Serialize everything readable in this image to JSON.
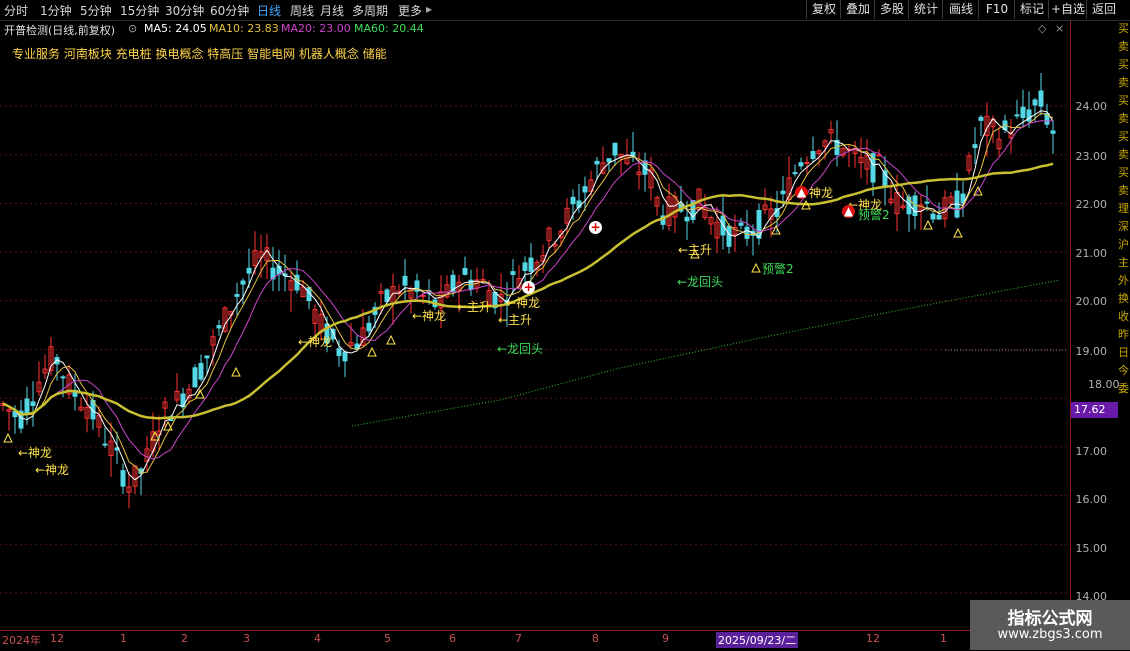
{
  "toolbar": {
    "periods": [
      "分时",
      "1分钟",
      "5分钟",
      "15分钟",
      "30分钟",
      "60分钟",
      "日线",
      "周线",
      "月线",
      "多周期",
      "更多"
    ],
    "active_period": "日线",
    "buttons": [
      "复权",
      "叠加",
      "多股",
      "统计",
      "画线",
      "F10",
      "标记",
      "+自选",
      "返回"
    ]
  },
  "info": {
    "stock_title": "开普检测(日线,前复权)",
    "ma5": "MA5: 24.05",
    "ma10": "MA10: 23.83",
    "ma20": "MA20: 23.00",
    "ma60": "MA60: 20.44",
    "concepts": "专业服务  河南板块  充电桩  换电概念  特高压  智能电网  机器人概念  储能"
  },
  "colors": {
    "up": "#ff3232",
    "down": "#54d8e6",
    "ma5": "#ffffff",
    "ma10": "#e6c040",
    "ma20": "#cc44cc",
    "ma60": "#c8c030",
    "long_ma": "#2ec82e",
    "grid": "#5a1010"
  },
  "axis": {
    "price_labels": [
      "24.00",
      "23.00",
      "22.00",
      "21.00",
      "20.00",
      "19.00",
      "18.00",
      "17.00",
      "16.00",
      "15.00",
      "14.00"
    ],
    "current_price": "17.62"
  },
  "time_axis": {
    "labels": [
      "2024年",
      "12",
      "1",
      "2",
      "3",
      "4",
      "5",
      "6",
      "7",
      "8",
      "9",
      "2025/09/23/二",
      "12",
      "1"
    ],
    "highlight": "2025/09/23/二"
  },
  "signals": [
    {
      "text": "←神龙",
      "type": "y"
    },
    {
      "text": "←神龙",
      "type": "y"
    },
    {
      "text": "←神龙",
      "type": "y"
    },
    {
      "text": "←神龙",
      "type": "y"
    },
    {
      "text": "←主升",
      "type": "y"
    },
    {
      "text": "←神龙",
      "type": "y"
    },
    {
      "text": "←主升",
      "type": "y"
    },
    {
      "text": "←龙回头",
      "type": "g"
    },
    {
      "text": "←龙回头",
      "type": "g"
    },
    {
      "text": "←主升",
      "type": "y"
    },
    {
      "text": "预警2",
      "type": "g"
    },
    {
      "text": "←神龙",
      "type": "y"
    },
    {
      "text": "←神龙",
      "type": "y"
    },
    {
      "text": "预警2",
      "type": "g"
    }
  ],
  "watermark": {
    "line1": "指标公式网",
    "line2": "www.zbgs3.com"
  },
  "right_strip": [
    "买",
    "卖",
    "买",
    "卖",
    "买",
    "卖",
    "买",
    "卖",
    "买",
    "卖",
    "理",
    "深",
    "沪",
    "主",
    "外",
    "换",
    "收",
    "昨",
    "日",
    "今",
    "委"
  ]
}
